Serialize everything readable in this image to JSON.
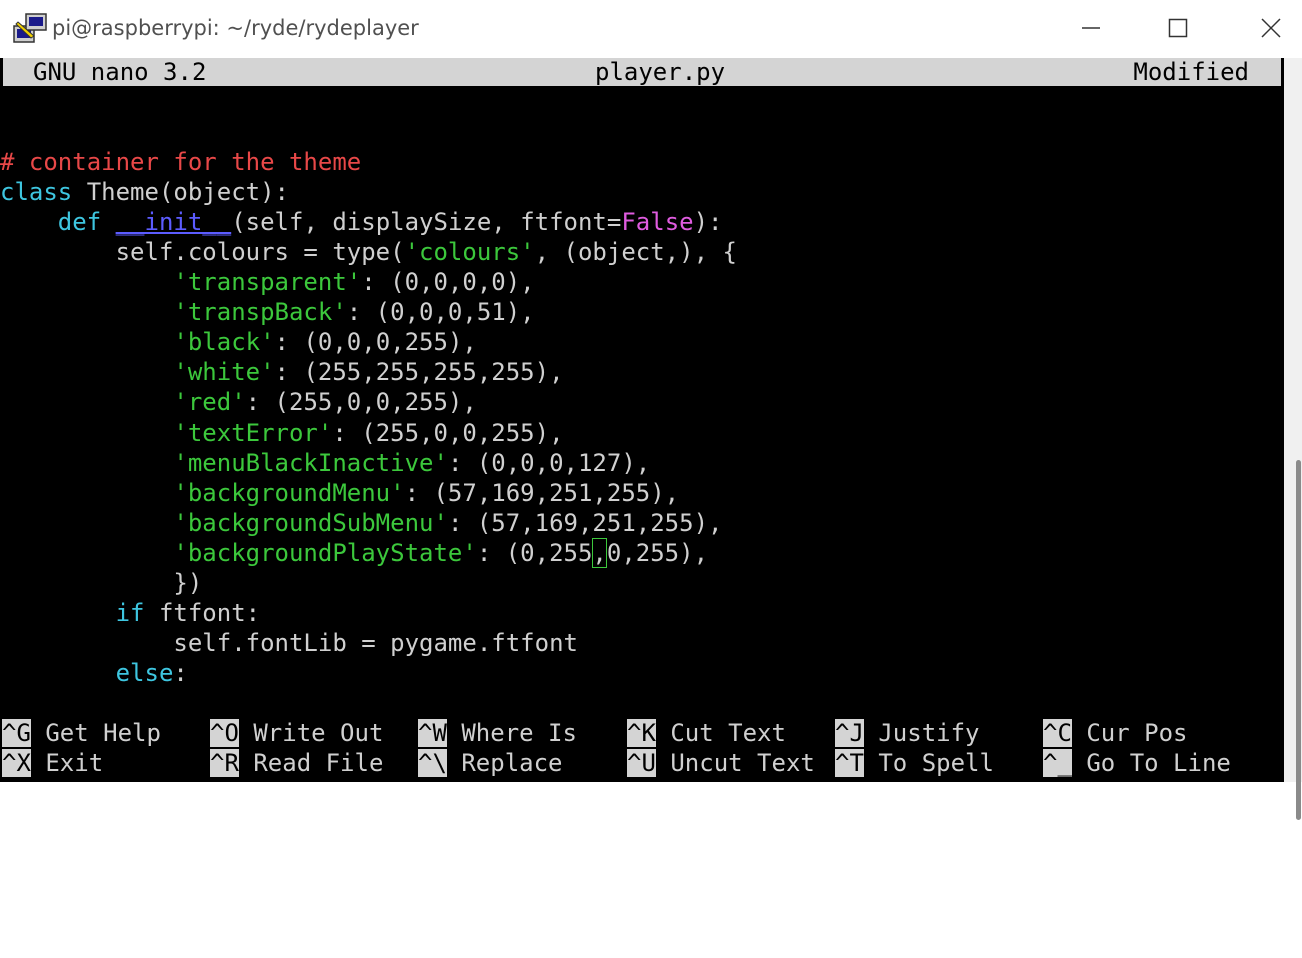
{
  "window": {
    "title": "pi@raspberrypi: ~/ryde/rydeplayer"
  },
  "nano_header": {
    "version": "GNU nano 3.2",
    "filename": "player.py",
    "status": "Modified"
  },
  "code": {
    "line1": {
      "comment": "# container for the theme"
    },
    "line2": {
      "kw": "class",
      "rest": " Theme(object):"
    },
    "line3": {
      "indent": "    ",
      "kw": "def",
      "sp": " ",
      "func": "__init__",
      "args": "(self, displaySize, ftfont=",
      "const": "False",
      "end": "):"
    },
    "line4": {
      "indent": "        ",
      "pre": "self.colours = type(",
      "str": "'colours'",
      "post": ", (object,), {"
    },
    "entries": [
      {
        "key": "'transparent'",
        "value": ": (0,0,0,0),"
      },
      {
        "key": "'transpBack'",
        "value": ": (0,0,0,51),"
      },
      {
        "key": "'black'",
        "value": ": (0,0,0,255),"
      },
      {
        "key": "'white'",
        "value": ": (255,255,255,255),"
      },
      {
        "key": "'red'",
        "value": ": (255,0,0,255),"
      },
      {
        "key": "'textError'",
        "value": ": (255,0,0,255),"
      },
      {
        "key": "'menuBlackInactive'",
        "value": ": (0,0,0,127),"
      },
      {
        "key": "'backgroundMenu'",
        "value": ": (57,169,251,255),"
      },
      {
        "key": "'backgroundSubMenu'",
        "value": ": (57,169,251,255),"
      }
    ],
    "last_entry": {
      "key": "'backgroundPlayState'",
      "pre": ": (0,255",
      "cursor": ",",
      "post": "0,255),"
    },
    "close": "})",
    "if_line": {
      "kw": "if",
      "rest": " ftfont:"
    },
    "assign": "self.fontLib = pygame.ftfont",
    "else_line": {
      "kw": "else",
      "rest": ":"
    }
  },
  "shortcuts": {
    "row1": [
      {
        "key": "^G",
        "label": "Get Help"
      },
      {
        "key": "^O",
        "label": "Write Out"
      },
      {
        "key": "^W",
        "label": "Where Is"
      },
      {
        "key": "^K",
        "label": "Cut Text"
      },
      {
        "key": "^J",
        "label": "Justify"
      },
      {
        "key": "^C",
        "label": "Cur Pos"
      }
    ],
    "row2": [
      {
        "key": "^X",
        "label": "Exit"
      },
      {
        "key": "^R",
        "label": "Read File"
      },
      {
        "key": "^\\",
        "label": "Replace"
      },
      {
        "key": "^U",
        "label": "Uncut Text"
      },
      {
        "key": "^T",
        "label": "To Spell"
      },
      {
        "key": "^_",
        "label": "Go To Line"
      }
    ]
  },
  "colors": {
    "terminal_bg": "#000000",
    "comment": "#e84848",
    "keyword": "#3ec6e0",
    "string": "#3cc83c",
    "function": "#5c5cff",
    "constant": "#e05ce0",
    "header_bg": "#d4d4d4"
  },
  "icons": {
    "app": "putty-icon",
    "minimize": "minimize-icon",
    "maximize": "maximize-icon",
    "close": "close-icon"
  }
}
